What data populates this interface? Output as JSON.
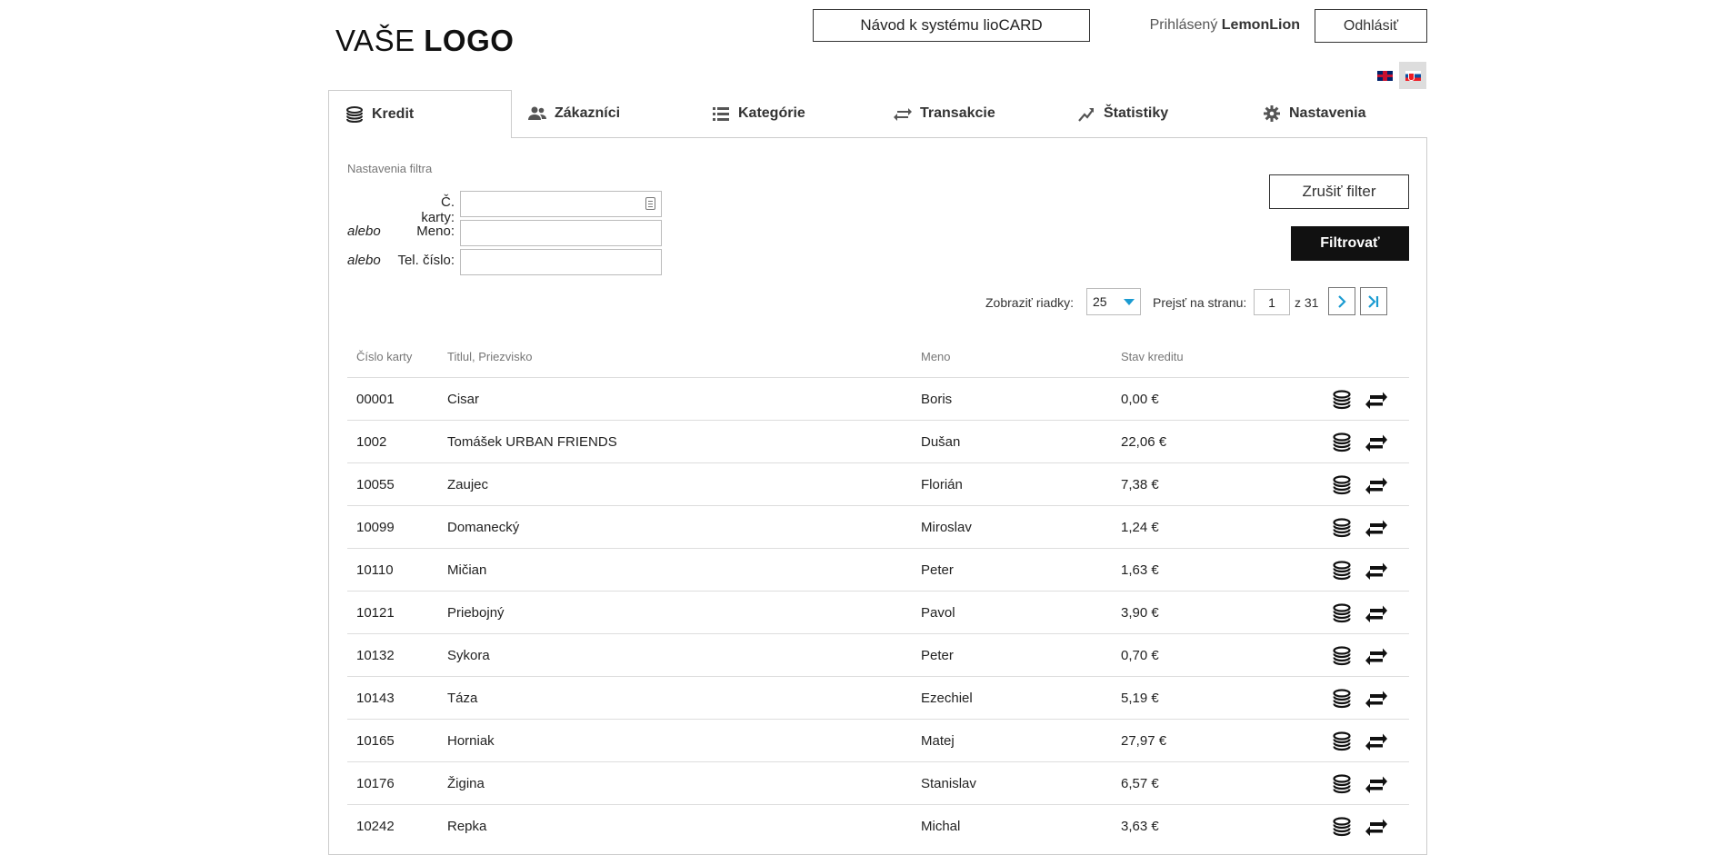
{
  "header": {
    "logo_part1": "VAŠE ",
    "logo_part2": "LOGO",
    "guide_button": "Návod k systému lioCARD",
    "logged_prefix": "Prihlásený ",
    "logged_user": "LemonLion",
    "logout_button": "Odhlásiť"
  },
  "tabs": [
    {
      "label": "Kredit",
      "icon": "coins-icon",
      "active": true
    },
    {
      "label": "Zákazníci",
      "icon": "users-icon",
      "active": false
    },
    {
      "label": "Kategórie",
      "icon": "list-icon",
      "active": false
    },
    {
      "label": "Transakcie",
      "icon": "exchange-icon",
      "active": false
    },
    {
      "label": "Štatistiky",
      "icon": "chart-line-icon",
      "active": false
    },
    {
      "label": "Nastavenia",
      "icon": "gear-icon",
      "active": false
    }
  ],
  "filter": {
    "title": "Nastavenia filtra",
    "or_word": "alebo",
    "card_label": "Č. karty:",
    "name_label": "Meno:",
    "phone_label": "Tel. číslo:",
    "card_value": "",
    "name_value": "",
    "phone_value": "",
    "cancel_button": "Zrušiť filter",
    "filter_button": "Filtrovať"
  },
  "pager": {
    "rows_label": "Zobraziť riadky:",
    "rows_value": "25",
    "goto_label": "Prejsť na stranu:",
    "page_value": "1",
    "page_total": "z 31"
  },
  "table": {
    "headers": [
      "Číslo karty",
      "Titlul, Priezvisko",
      "Meno",
      "Stav kreditu"
    ],
    "rows": [
      {
        "card": "00001",
        "surname": "Cisar",
        "name": "Boris",
        "credit": "0,00 €"
      },
      {
        "card": "1002",
        "surname": "Tomášek URBAN FRIENDS",
        "name": "Dušan",
        "credit": "22,06 €"
      },
      {
        "card": "10055",
        "surname": "Zaujec",
        "name": "Florián",
        "credit": "7,38 €"
      },
      {
        "card": "10099",
        "surname": "Domanecký",
        "name": "Miroslav",
        "credit": "1,24 €"
      },
      {
        "card": "10110",
        "surname": "Mičian",
        "name": "Peter",
        "credit": "1,63 €"
      },
      {
        "card": "10121",
        "surname": "Priebojný",
        "name": "Pavol",
        "credit": "3,90 €"
      },
      {
        "card": "10132",
        "surname": "Sykora",
        "name": "Peter",
        "credit": "0,70 €"
      },
      {
        "card": "10143",
        "surname": "Táza",
        "name": "Ezechiel",
        "credit": "5,19 €"
      },
      {
        "card": "10165",
        "surname": "Horniak",
        "name": "Matej",
        "credit": "27,97 €"
      },
      {
        "card": "10176",
        "surname": "Žigina",
        "name": "Stanislav",
        "credit": "6,57 €"
      },
      {
        "card": "10242",
        "surname": "Repka",
        "name": "Michal",
        "credit": "3,63 €"
      }
    ]
  },
  "colors": {
    "accent": "#1b9bd1",
    "dark_button": "#111111",
    "border": "#cccccc"
  }
}
